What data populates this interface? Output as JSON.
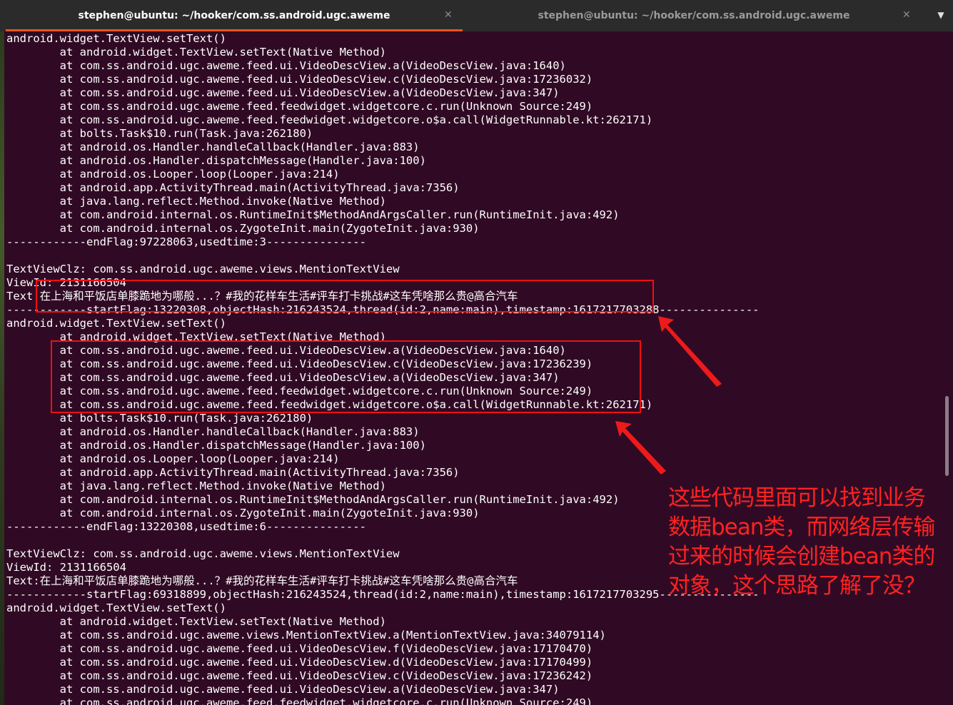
{
  "tabs": [
    {
      "title": "stephen@ubuntu: ~/hooker/com.ss.android.ugc.aweme",
      "active": true
    },
    {
      "title": "stephen@ubuntu: ~/hooker/com.ss.android.ugc.aweme",
      "active": false
    }
  ],
  "icons": {
    "tab_close": "close-icon",
    "menu": "chevron-down-icon"
  },
  "colors": {
    "terminal_bg": "#300a24",
    "text": "#ffffff",
    "accent": "#e95420",
    "annotation": "#ff2222"
  },
  "terminal_lines": [
    "android.widget.TextView.setText()",
    "        at android.widget.TextView.setText(Native Method)",
    "        at com.ss.android.ugc.aweme.feed.ui.VideoDescView.a(VideoDescView.java:1640)",
    "        at com.ss.android.ugc.aweme.feed.ui.VideoDescView.c(VideoDescView.java:17236032)",
    "        at com.ss.android.ugc.aweme.feed.ui.VideoDescView.a(VideoDescView.java:347)",
    "        at com.ss.android.ugc.aweme.feed.feedwidget.widgetcore.c.run(Unknown Source:249)",
    "        at com.ss.android.ugc.aweme.feed.feedwidget.widgetcore.o$a.call(WidgetRunnable.kt:262171)",
    "        at bolts.Task$10.run(Task.java:262180)",
    "        at android.os.Handler.handleCallback(Handler.java:883)",
    "        at android.os.Handler.dispatchMessage(Handler.java:100)",
    "        at android.os.Looper.loop(Looper.java:214)",
    "        at android.app.ActivityThread.main(ActivityThread.java:7356)",
    "        at java.lang.reflect.Method.invoke(Native Method)",
    "        at com.android.internal.os.RuntimeInit$MethodAndArgsCaller.run(RuntimeInit.java:492)",
    "        at com.android.internal.os.ZygoteInit.main(ZygoteInit.java:930)",
    "------------endFlag:97228063,usedtime:3---------------",
    "",
    "TextViewClz: com.ss.android.ugc.aweme.views.MentionTextView",
    "ViewId: 2131166504",
    "Text:在上海和平饭店单膝跪地为哪般...？#我的花样车生活#评车打卡挑战#这车凭啥那么贵@高合汽车",
    "------------startFlag:13220308,objectHash:216243524,thread(id:2,name:main),timestamp:1617217703288---------------",
    "android.widget.TextView.setText()",
    "        at android.widget.TextView.setText(Native Method)",
    "        at com.ss.android.ugc.aweme.feed.ui.VideoDescView.a(VideoDescView.java:1640)",
    "        at com.ss.android.ugc.aweme.feed.ui.VideoDescView.c(VideoDescView.java:17236239)",
    "        at com.ss.android.ugc.aweme.feed.ui.VideoDescView.a(VideoDescView.java:347)",
    "        at com.ss.android.ugc.aweme.feed.feedwidget.widgetcore.c.run(Unknown Source:249)",
    "        at com.ss.android.ugc.aweme.feed.feedwidget.widgetcore.o$a.call(WidgetRunnable.kt:262171)",
    "        at bolts.Task$10.run(Task.java:262180)",
    "        at android.os.Handler.handleCallback(Handler.java:883)",
    "        at android.os.Handler.dispatchMessage(Handler.java:100)",
    "        at android.os.Looper.loop(Looper.java:214)",
    "        at android.app.ActivityThread.main(ActivityThread.java:7356)",
    "        at java.lang.reflect.Method.invoke(Native Method)",
    "        at com.android.internal.os.RuntimeInit$MethodAndArgsCaller.run(RuntimeInit.java:492)",
    "        at com.android.internal.os.ZygoteInit.main(ZygoteInit.java:930)",
    "------------endFlag:13220308,usedtime:6---------------",
    "",
    "TextViewClz: com.ss.android.ugc.aweme.views.MentionTextView",
    "ViewId: 2131166504",
    "Text:在上海和平饭店单膝跪地为哪般...？#我的花样车生活#评车打卡挑战#这车凭啥那么贵@高合汽车",
    "------------startFlag:69318899,objectHash:216243524,thread(id:2,name:main),timestamp:1617217703295---------------",
    "android.widget.TextView.setText()",
    "        at android.widget.TextView.setText(Native Method)",
    "        at com.ss.android.ugc.aweme.views.MentionTextView.a(MentionTextView.java:34079114)",
    "        at com.ss.android.ugc.aweme.feed.ui.VideoDescView.f(VideoDescView.java:17170470)",
    "        at com.ss.android.ugc.aweme.feed.ui.VideoDescView.d(VideoDescView.java:17170499)",
    "        at com.ss.android.ugc.aweme.feed.ui.VideoDescView.c(VideoDescView.java:17236242)",
    "        at com.ss.android.ugc.aweme.feed.ui.VideoDescView.a(VideoDescView.java:347)",
    "        at com.ss.android.ugc.aweme.feed.feedwidget.widgetcore.c.run(Unknown Source:249)"
  ],
  "annotation": {
    "lines": [
      "这些代码里面可以找到业务",
      "数据bean类，而网络层传输",
      "过来的时候会创建bean类的",
      "对象，这个思路了解了没？"
    ]
  }
}
